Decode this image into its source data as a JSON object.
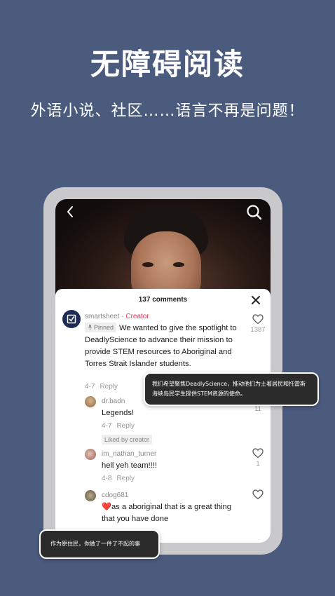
{
  "headline": "无障碍阅读",
  "subline": "外语小说、社区……语言不再是问题！",
  "icons": {
    "back": "chevron-left-icon",
    "search": "search-icon",
    "close": "close-icon",
    "like": "heart-icon",
    "pin": "pin-icon"
  },
  "comments_panel": {
    "title": "137 comments",
    "comments": [
      {
        "username": "smartsheet",
        "creator_label": "· Creator",
        "pinned_label": "Pinned",
        "text": "We wanted to give the spotlight to DeadlyScience to advance their mission to provide STEM resources to Aboriginal and Torres Strait Islander students.",
        "date": "4-7",
        "reply": "Reply",
        "likes": "1387"
      },
      {
        "username": "dr.badn",
        "text": "Legends!",
        "date": "4-7",
        "reply": "Reply",
        "badge": "Liked by creator",
        "likes": "11"
      },
      {
        "username": "im_nathan_turner",
        "text": "hell yeh team!!!!",
        "date": "4-8",
        "reply": "Reply",
        "likes": "1"
      },
      {
        "username": "cdog681",
        "emoji": "❤️",
        "text": "as a aboriginal that is a great thing that you have done",
        "likes": ""
      }
    ]
  },
  "translations": {
    "bubble_1": "我们希望聚焦DeadlyScience，推动他们为土著居民和托雷斯海峡岛民学生提供STEM资源的使命。",
    "bubble_2": "作为原住民，你做了一件了不起的事"
  },
  "colors": {
    "background": "#4b5b7e",
    "creator": "#e8375a",
    "bubble": "#2b2b2b"
  }
}
